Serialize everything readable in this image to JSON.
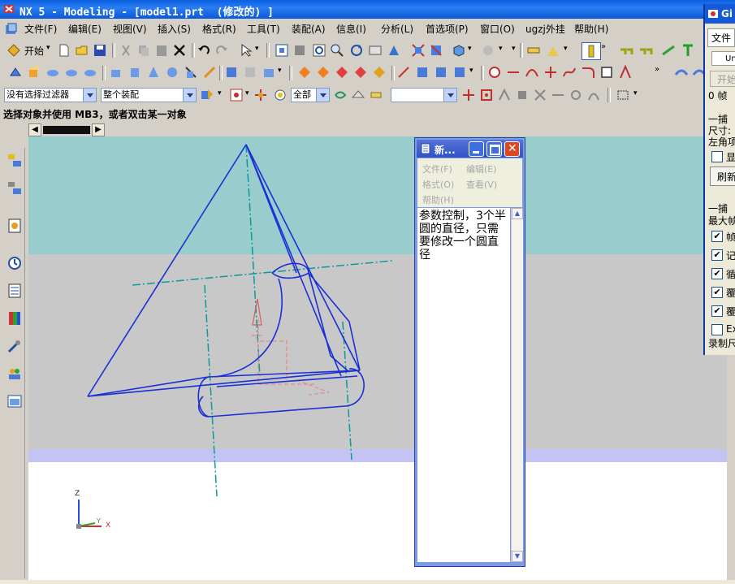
{
  "window": {
    "title": "NX 5 - Modeling - [model1.prt  (修改的) ]"
  },
  "menubar": {
    "items": [
      "文件(F)",
      "编辑(E)",
      "视图(V)",
      "插入(S)",
      "格式(R)",
      "工具(T)",
      "装配(A)",
      "信息(I)",
      "分析(L)",
      "首选项(P)",
      "窗口(O)",
      "ugzj外挂",
      "帮助(H)"
    ]
  },
  "toolbar": {
    "start_label": "开始"
  },
  "selection_bar": {
    "filter_value": "没有选择过滤器",
    "scope_value": "整个装配",
    "snap_value": "全部",
    "extra_value": ""
  },
  "cue_line": "选择对象并使用 MB3，或者双击某一对象",
  "triad": {
    "x": "X",
    "y": "Y",
    "z": "Z"
  },
  "notepad": {
    "title": "新...",
    "menu": [
      "文件(F)",
      "编辑(E)",
      "格式(O)",
      "查看(V)",
      "帮助(H)"
    ],
    "text": "参数控制，3个半圆的直径，只需要修改一个圆直径"
  },
  "right_panel": {
    "title": "Gi",
    "tab": "文件",
    "field1": "Un",
    "button_start": "开始",
    "frames": "0 帧",
    "group1": "一捕",
    "size_label": "尺寸:",
    "corner_label": "左角项",
    "show_label": "显",
    "refresh_button": "刷新",
    "group2": "一捕",
    "max_label": "最大帧",
    "checks": [
      {
        "label": "帧",
        "checked": true
      },
      {
        "label": "记",
        "checked": true
      },
      {
        "label": "循",
        "checked": true
      },
      {
        "label": "覆",
        "checked": true
      },
      {
        "label": "覆",
        "checked": true
      },
      {
        "label": "Ex",
        "checked": false
      }
    ],
    "record_label": "录制尺"
  },
  "colors": {
    "viewport_top": "#99cccc",
    "viewport_mid": "#c8c8c8",
    "viewport_band": "#c4c4f4",
    "viewport_bottom": "#ffffff",
    "wire_blue": "#1a2fd6",
    "centerline_teal": "#0a9a9a",
    "hidden_pink": "#e58a8a"
  }
}
